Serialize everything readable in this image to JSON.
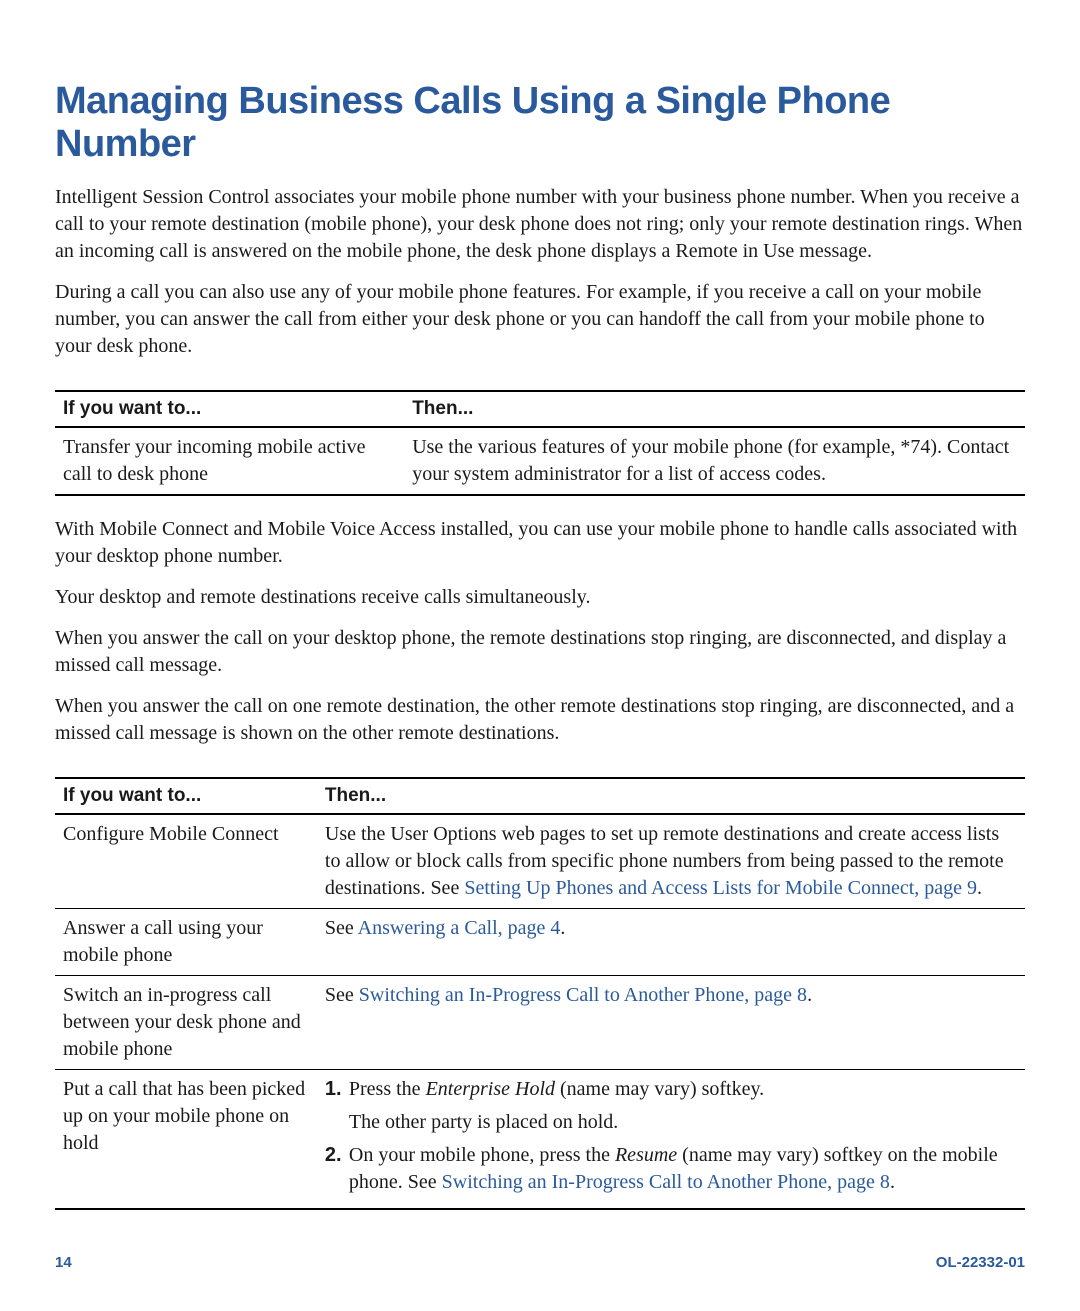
{
  "title": "Managing Business Calls Using a Single Phone Number",
  "paras": {
    "p1": "Intelligent Session Control associates your mobile phone number with your business phone number. When you receive a call to your remote destination (mobile phone), your desk phone does not ring; only your remote destination rings. When an incoming call is answered on the mobile phone, the desk phone displays a Remote in Use message.",
    "p2": "During a call you can also use any of your mobile phone features. For example, if you receive a call on your mobile number, you can answer the call from either your desk phone or you can handoff the call from your mobile phone to your desk phone.",
    "p3": "With Mobile Connect and Mobile Voice Access installed, you can use your mobile phone to handle calls associated with your desktop phone number.",
    "p4": "Your desktop and remote destinations receive calls simultaneously.",
    "p5": "When you answer the call on your desktop phone, the remote destinations stop ringing, are disconnected, and display a missed call message.",
    "p6": "When you answer the call on one remote destination, the other remote destinations stop ringing, are disconnected, and a missed call message is shown on the other remote destinations."
  },
  "table1": {
    "head1": "If you want to...",
    "head2": "Then...",
    "row1c1": "Transfer your incoming mobile active call to desk phone",
    "row1c2": "Use the various features of your mobile phone (for example, *74). Contact your system administrator for a list of access codes."
  },
  "table2": {
    "head1": "If you want to...",
    "head2": "Then...",
    "r1c1": "Configure Mobile Connect",
    "r1c2a": "Use the User Options web pages to set up remote destinations and create access lists to allow or block calls from specific phone numbers from being passed to the remote destinations. See ",
    "r1c2link": "Setting Up Phones and Access Lists for Mobile Connect, page 9",
    "r1c2b": ".",
    "r2c1": "Answer a call using your mobile phone",
    "r2c2a": "See ",
    "r2c2link": "Answering a Call, page 4",
    "r2c2b": ".",
    "r3c1": "Switch an in-progress call between your desk phone and mobile phone",
    "r3c2a": "See ",
    "r3c2link": "Switching an In-Progress Call to Another Phone, page 8",
    "r3c2b": ".",
    "r4c1": "Put a call that has been picked up on your mobile phone on hold",
    "r4s1num": "1.",
    "r4s1a": "Press the ",
    "r4s1i": "Enterprise Hold",
    "r4s1b": " (name may vary) softkey.",
    "r4s1sub": "The other party is placed on hold.",
    "r4s2num": "2.",
    "r4s2a": "On your mobile phone, press the ",
    "r4s2i": "Resume",
    "r4s2b": " (name may vary) softkey on the mobile phone. See ",
    "r4s2link": "Switching an In-Progress Call to Another Phone, page 8",
    "r4s2c": "."
  },
  "footer": {
    "page": "14",
    "docid": "OL-22332-01"
  }
}
